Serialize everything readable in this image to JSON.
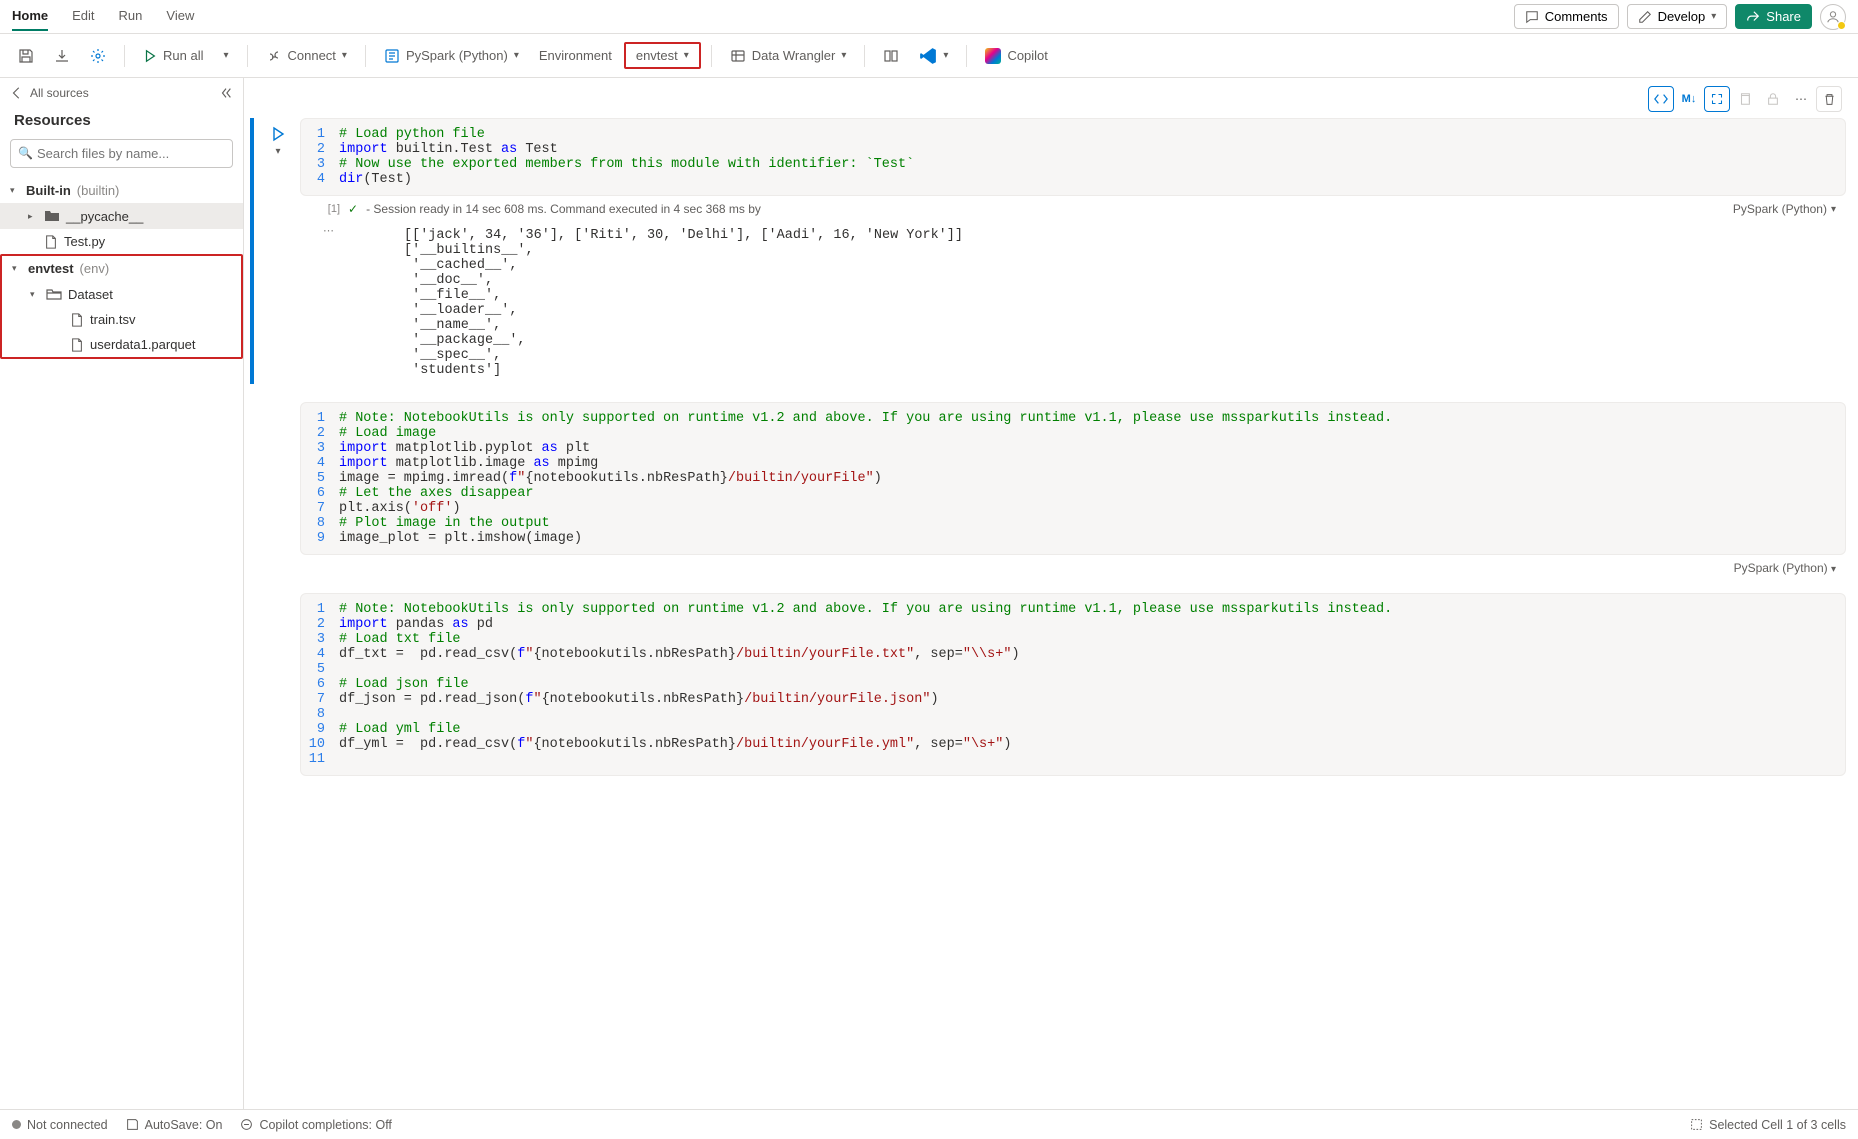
{
  "menu": {
    "tabs": [
      "Home",
      "Edit",
      "Run",
      "View"
    ],
    "active": 0,
    "comments": "Comments",
    "develop": "Develop",
    "share": "Share"
  },
  "toolbar": {
    "runall": "Run all",
    "connect": "Connect",
    "kernel": "PySpark (Python)",
    "environment": "Environment",
    "envtest": "envtest",
    "datawrangler": "Data Wrangler",
    "copilot": "Copilot"
  },
  "sidebar": {
    "back": "All sources",
    "title": "Resources",
    "search_placeholder": "Search files by name...",
    "builtin_label": "Built-in",
    "builtin_hint": "(builtin)",
    "pycache": "__pycache__",
    "testpy": "Test.py",
    "envtest_label": "envtest",
    "envtest_hint": "(env)",
    "dataset": "Dataset",
    "train": "train.tsv",
    "userdata": "userdata1.parquet"
  },
  "cells": [
    {
      "exec_count": "[1]",
      "status": "- Session ready in 14 sec 608 ms. Command executed in 4 sec 368 ms by",
      "kernel": "PySpark (Python)",
      "output": "[['jack', 34, '36'], ['Riti', 30, 'Delhi'], ['Aadi', 16, 'New York']]\n['__builtins__',\n '__cached__',\n '__doc__',\n '__file__',\n '__loader__',\n '__name__',\n '__package__',\n '__spec__',\n 'students']"
    },
    {
      "kernel": "PySpark (Python)"
    },
    {}
  ],
  "statusbar": {
    "connection": "Not connected",
    "autosave": "AutoSave: On",
    "copilot": "Copilot completions: Off",
    "selection": "Selected Cell 1 of 3 cells"
  }
}
